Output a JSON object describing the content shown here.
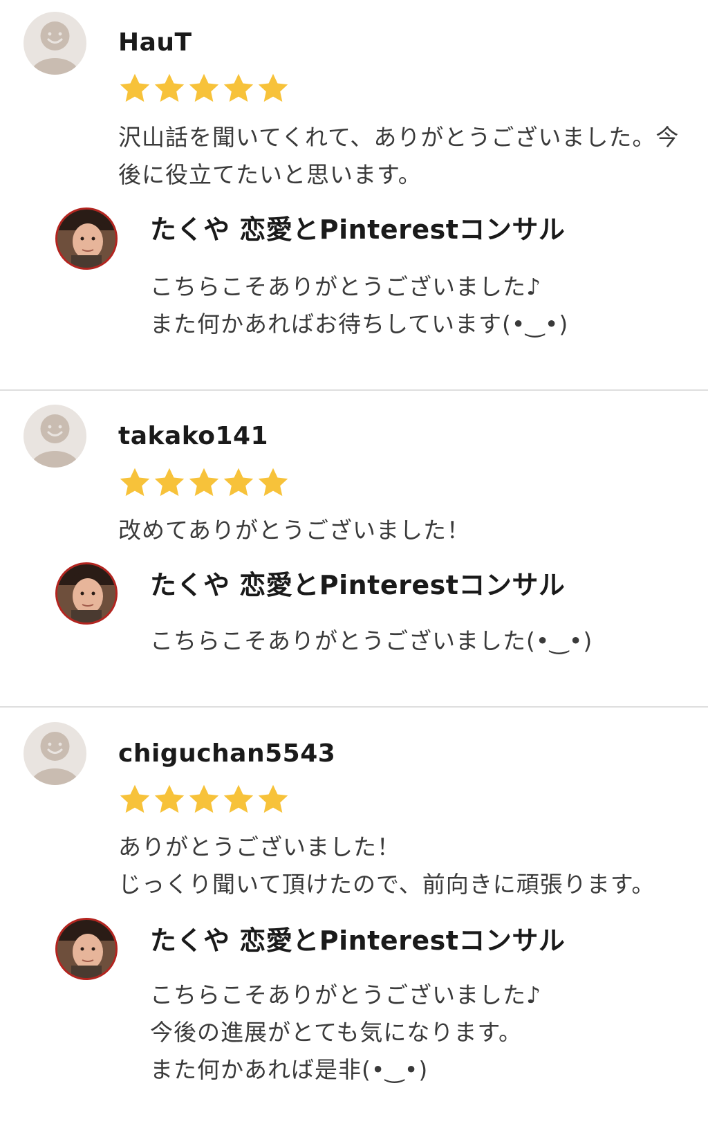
{
  "rating_max": 5,
  "colors": {
    "star": "#f7c23a",
    "avatar_bg": "#e9e4e0",
    "avatar_figure": "#c9bcb1",
    "seller_border": "#b3241f",
    "divider": "#dedede"
  },
  "reviews": [
    {
      "username": "HauT",
      "rating": 5,
      "comment_lines": [
        "沢山話を聞いてくれて、ありがとうございました。今",
        "後に役立てたいと思います。"
      ],
      "reply": {
        "seller_name": "たくや 恋愛とPinterestコンサル",
        "lines": [
          "こちらこそありがとうございました♪",
          "また何かあればお待ちしています(•‿•)"
        ]
      }
    },
    {
      "username": "takako141",
      "rating": 5,
      "comment_lines": [
        "改めてありがとうございました！"
      ],
      "reply": {
        "seller_name": "たくや 恋愛とPinterestコンサル",
        "lines": [
          "こちらこそありがとうございました(•‿•)"
        ]
      }
    },
    {
      "username": "chiguchan5543",
      "rating": 5,
      "comment_lines": [
        "ありがとうございました！",
        "じっくり聞いて頂けたので、前向きに頑張ります。"
      ],
      "reply": {
        "seller_name": "たくや 恋愛とPinterestコンサル",
        "lines": [
          "こちらこそありがとうございました♪",
          "今後の進展がとても気になります。",
          "また何かあれば是非(•‿•)"
        ]
      }
    }
  ]
}
